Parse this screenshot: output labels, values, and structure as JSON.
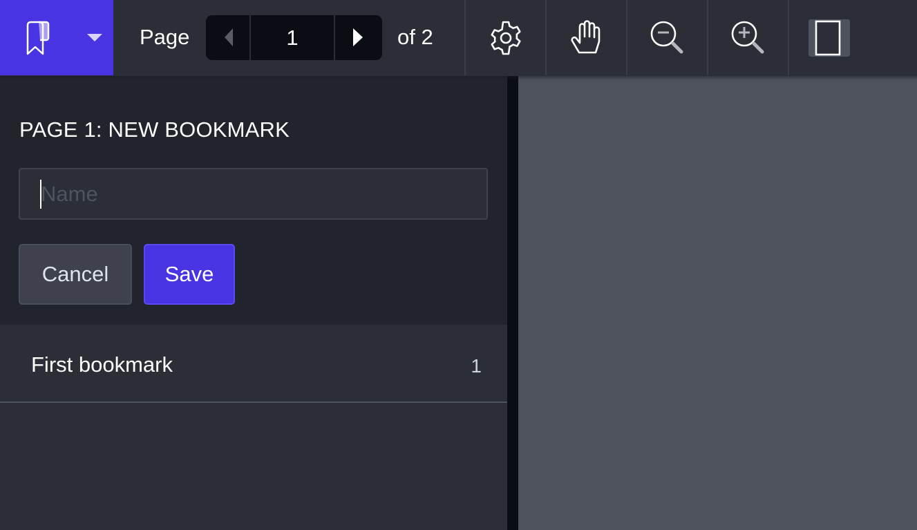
{
  "toolbar": {
    "bookmarks_button_icon": "bookmark-icon",
    "dropdown_icon": "caret-down-icon",
    "page_label": "Page",
    "current_page": "1",
    "of_label": "of 2",
    "total_pages": 2,
    "prev_icon": "chevron-left-icon",
    "next_icon": "chevron-right-icon",
    "tools": [
      {
        "name": "settings",
        "icon": "gear-icon"
      },
      {
        "name": "pan",
        "icon": "hand-icon"
      },
      {
        "name": "zoom-out",
        "icon": "zoom-out-icon"
      },
      {
        "name": "zoom-in",
        "icon": "zoom-in-icon"
      },
      {
        "name": "page-view",
        "icon": "single-page-icon"
      }
    ],
    "accent_color": "#4834e3"
  },
  "sidebar": {
    "form": {
      "title": "PAGE 1: NEW BOOKMARK",
      "name_value": "",
      "name_placeholder": "Name",
      "cancel_label": "Cancel",
      "save_label": "Save"
    },
    "bookmarks": [
      {
        "title": "First bookmark",
        "page": "1"
      }
    ]
  }
}
